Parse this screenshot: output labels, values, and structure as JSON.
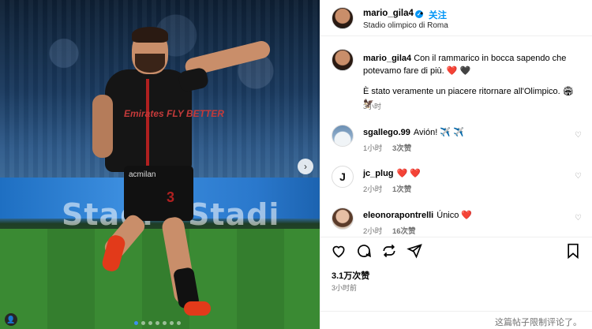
{
  "post": {
    "photo": {
      "board_text_1": "Stadi",
      "board_text_2": "Stadi",
      "jersey_sponsor": "Emirates FLY BETTER",
      "jersey_club": "acmilan",
      "jersey_number": "3",
      "carousel_dots": 7,
      "active_dot": 0
    },
    "header": {
      "username": "mario_gila4",
      "dot": "•",
      "follow_label": "关注",
      "location": "Stadio olimpico di Roma"
    },
    "caption": {
      "username": "mario_gila4",
      "text_line1": " Con il rammarico in bocca sapendo che potevamo fare di più. ❤️ 🖤",
      "text_line2": "È stato veramente un piacere ritornare all'Olimpico. 🏟 🦅",
      "time": "3小时"
    },
    "comments": [
      {
        "user": "sgallego.99",
        "text": "Avión! ✈️ ✈️",
        "time": "1小时",
        "likes": "3次赞"
      },
      {
        "user": "jc_plug",
        "text": "❤️ ❤️",
        "time": "2小时",
        "likes": "1次赞"
      },
      {
        "user": "eleonorapontrelli",
        "text": "Único ❤️",
        "time": "2小时",
        "likes": "16次赞"
      }
    ],
    "likes": "3.1万次赞",
    "time": "3小时前",
    "comments_disabled": "这篇帖子限制评论了。"
  },
  "colors": {
    "accent": "#0095f6",
    "heart_red": "#ed4956"
  },
  "icons": [
    "heart-icon",
    "comment-icon",
    "share-icon",
    "send-icon",
    "bookmark-icon",
    "chevron-right-icon",
    "verified-icon",
    "tag-icon"
  ]
}
